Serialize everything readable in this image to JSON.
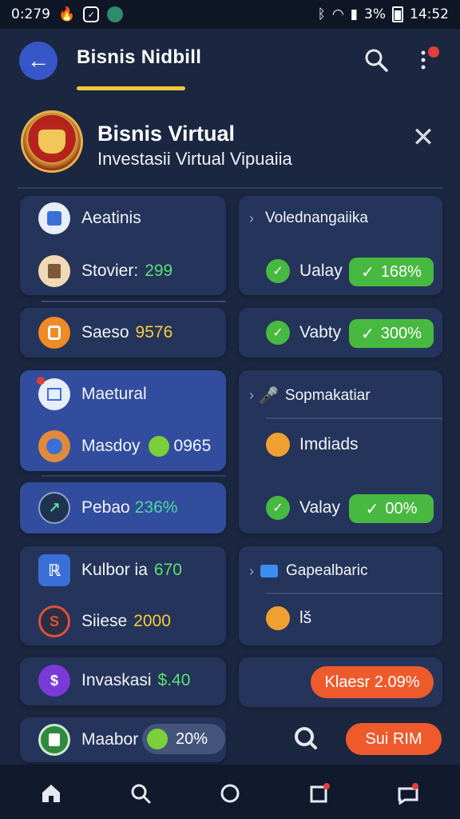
{
  "status_bar": {
    "time": "0:279",
    "battery": "3%",
    "clock": "14:52"
  },
  "header": {
    "title": "Bisnis Nidbill"
  },
  "title_card": {
    "title": "Bisnis Virtual",
    "subtitle": "Investasii Virtual Vipuaiia"
  },
  "left_cards": [
    {
      "label": "Aeatinis",
      "value": ""
    },
    {
      "label": "Stovier:",
      "value": "299"
    },
    {
      "label": "Saeso",
      "value": "9576"
    },
    {
      "label": "Maetural",
      "value": ""
    },
    {
      "label": "Masdoy",
      "value": "0965"
    },
    {
      "label": "Pebao",
      "value": "236%"
    },
    {
      "label": "Kulbor ia",
      "value": "670"
    },
    {
      "label": "Siiese",
      "value": "2000"
    },
    {
      "label": "Invaskasi",
      "value": "$.40"
    },
    {
      "label": "Maabor",
      "value": "20%"
    }
  ],
  "right_cards": {
    "r1_title": "Volednangaiika",
    "r1_label": "Ualay",
    "r1_pill": "168%",
    "r2_label": "Vabty",
    "r2_pill": "300%",
    "r3_title": "Sopmakatiar",
    "r3_label": "Imdiads",
    "r3_label2": "Valay",
    "r3_pill": "00%",
    "r4_title": "Gapealbaric",
    "r4_label": "lš",
    "r5_button": "Klaesr 2.09%",
    "r6_button": "Sui RIM"
  },
  "colors": {
    "background": "#1b2640",
    "card": "#25345a",
    "card_active": "#324d9e",
    "accent_green": "#48b940",
    "accent_orange": "#ee5a2c",
    "accent_yellow": "#f5c83a"
  },
  "icons": [
    "back-arrow-icon",
    "search-icon",
    "more-icon",
    "close-icon",
    "home-icon",
    "nav-search-icon",
    "circle-icon",
    "square-notification-icon",
    "chat-notification-icon"
  ]
}
